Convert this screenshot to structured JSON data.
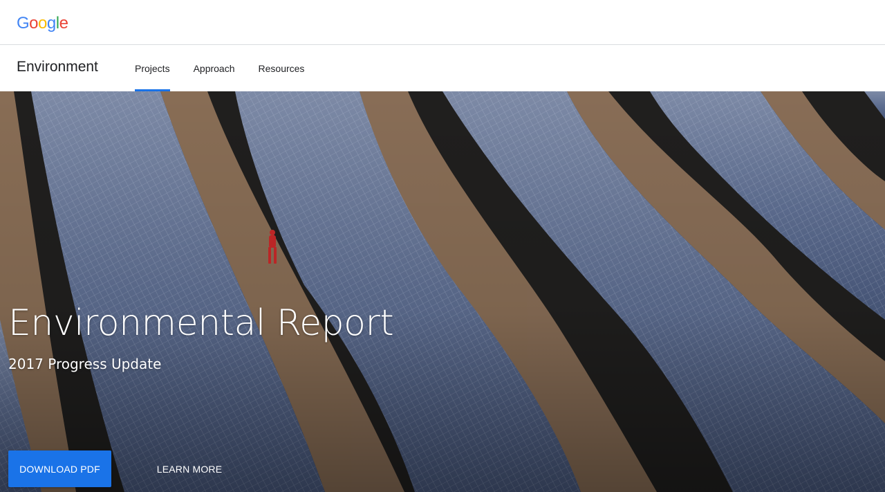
{
  "header": {
    "logo": {
      "letters": [
        "G",
        "o",
        "o",
        "g",
        "l",
        "e"
      ],
      "colors": [
        "#4285f4",
        "#ea4335",
        "#fbbc05",
        "#4285f4",
        "#34a853",
        "#ea4335"
      ]
    }
  },
  "nav": {
    "site_title": "Environment",
    "tabs": [
      {
        "label": "Projects",
        "active": true
      },
      {
        "label": "Approach",
        "active": false
      },
      {
        "label": "Resources",
        "active": false
      }
    ],
    "accent_color": "#1a73e8"
  },
  "hero": {
    "image": "solar panel field",
    "title": "Environmental Report",
    "subtitle": "2017 Progress Update",
    "primary_button": "DOWNLOAD PDF",
    "secondary_button": "LEARN MORE"
  }
}
